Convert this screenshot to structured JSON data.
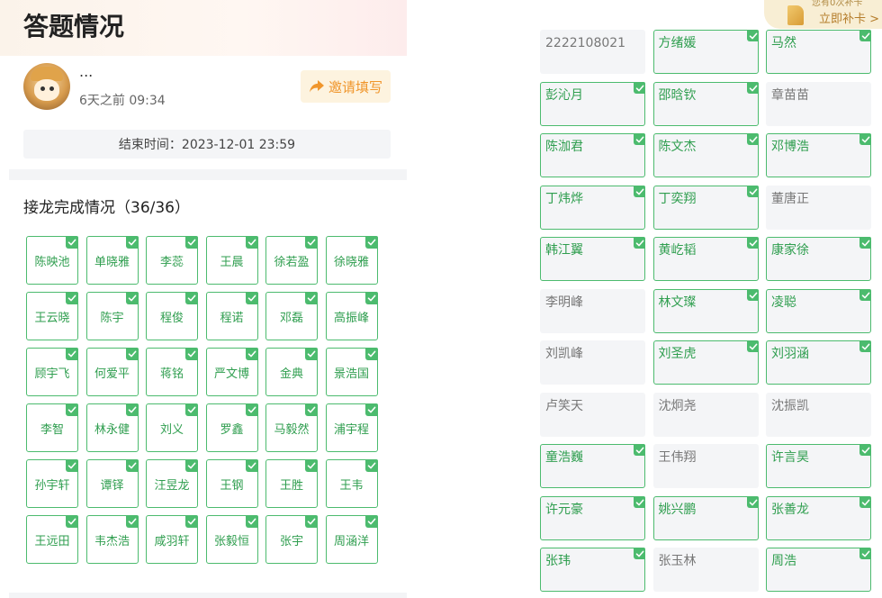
{
  "page": {
    "title": "答题情况",
    "user": {
      "name": "...",
      "time": "6天之前 09:34"
    },
    "invite_label": "邀请填写",
    "end_time": "结束时间：2023-12-01 23:59",
    "section_title": "接龙完成情况（36/36）"
  },
  "left_grid": {
    "names": [
      "陈映池",
      "单晓雅",
      "李蕊",
      "王晨",
      "徐若盈",
      "徐晓雅",
      "王云晓",
      "陈宇",
      "程俊",
      "程诺",
      "邓磊",
      "高振峰",
      "顾宇飞",
      "何爱平",
      "蒋铭",
      "严文博",
      "金典",
      "景浩国",
      "李智",
      "林永健",
      "刘义",
      "罗鑫",
      "马毅然",
      "浦宇程",
      "孙宇轩",
      "谭铎",
      "汪昱龙",
      "王钢",
      "王胜",
      "王韦",
      "王远田",
      "韦杰浩",
      "咸羽轩",
      "张毅恒",
      "张宇",
      "周涵洋"
    ]
  },
  "right_panel": {
    "badge": {
      "hint": "您有0次补卡",
      "label": "立即补卡 >"
    },
    "items": [
      {
        "name": "2222108021",
        "done": false
      },
      {
        "name": "方绪媛",
        "done": true
      },
      {
        "name": "马然",
        "done": true
      },
      {
        "name": "彭沁月",
        "done": true
      },
      {
        "name": "邵晗钦",
        "done": true
      },
      {
        "name": "章苗苗",
        "done": false
      },
      {
        "name": "陈泇君",
        "done": true
      },
      {
        "name": "陈文杰",
        "done": true
      },
      {
        "name": "邓博浩",
        "done": true
      },
      {
        "name": "丁炜烨",
        "done": true
      },
      {
        "name": "丁奕翔",
        "done": true
      },
      {
        "name": "董唐正",
        "done": false
      },
      {
        "name": "韩江翼",
        "done": true
      },
      {
        "name": "黄屹韬",
        "done": true
      },
      {
        "name": "康家徐",
        "done": true
      },
      {
        "name": "李明峰",
        "done": false
      },
      {
        "name": "林文璨",
        "done": true
      },
      {
        "name": "凌聪",
        "done": true
      },
      {
        "name": "刘凯峰",
        "done": false
      },
      {
        "name": "刘圣虎",
        "done": true
      },
      {
        "name": "刘羽涵",
        "done": true
      },
      {
        "name": "卢笑天",
        "done": false
      },
      {
        "name": "沈炯尧",
        "done": false
      },
      {
        "name": "沈振凯",
        "done": false
      },
      {
        "name": "童浩巍",
        "done": true
      },
      {
        "name": "王伟翔",
        "done": false
      },
      {
        "name": "许言昊",
        "done": true
      },
      {
        "name": "许元豪",
        "done": true
      },
      {
        "name": "姚兴鹏",
        "done": true
      },
      {
        "name": "张善龙",
        "done": true
      },
      {
        "name": "张玮",
        "done": true
      },
      {
        "name": "张玉林",
        "done": false
      },
      {
        "name": "周浩",
        "done": true
      }
    ]
  },
  "colors": {
    "accent_green": "#4cbb6e",
    "invite_orange": "#f0962c",
    "badge_gold": "#b57d2b"
  }
}
